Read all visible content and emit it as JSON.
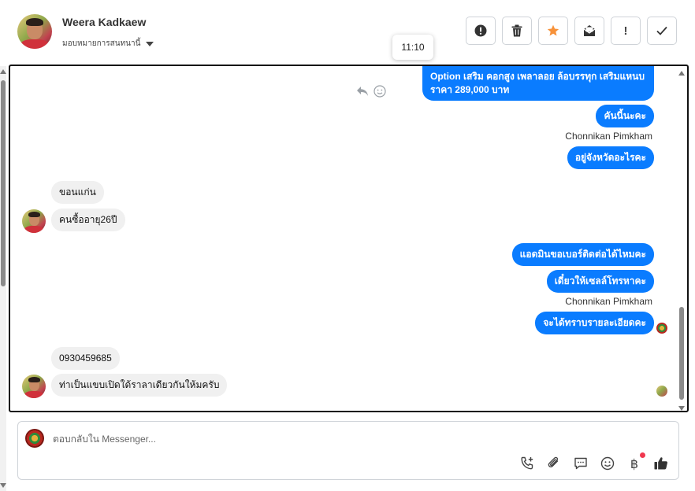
{
  "header": {
    "contact_name": "Weera Kadkaew",
    "assign_label": "มอบหมายการสนทนานี้",
    "toolbar": [
      {
        "name": "report-button",
        "icon": "alert-circle-icon"
      },
      {
        "name": "delete-button",
        "icon": "trash-icon"
      },
      {
        "name": "star-button",
        "icon": "star-icon"
      },
      {
        "name": "mark-unread-button",
        "icon": "envelope-icon",
        "label": ""
      },
      {
        "name": "important-button",
        "icon": "exclamation-icon",
        "label": "!"
      },
      {
        "name": "done-button",
        "icon": "check-icon"
      }
    ]
  },
  "tooltip": {
    "time": "11:10"
  },
  "messages": [
    {
      "id": "m1",
      "dir": "out",
      "lines": [
        " Option เสริม คอกสูง เพลาลอย ล้อบรรทุก เสริมแหนบ",
        "ราคา 289,000 บาท"
      ]
    },
    {
      "id": "m2",
      "dir": "out",
      "text": "คันนี้นะคะ"
    },
    {
      "id": "s1",
      "sender": "Chonnikan Pimkham"
    },
    {
      "id": "m3",
      "dir": "out",
      "text": "อยู่จังหวัดอะไรคะ"
    },
    {
      "id": "m4",
      "dir": "in",
      "text": "ขอนแก่น"
    },
    {
      "id": "m5",
      "dir": "in",
      "text": "คนซื้ออายุ26ปี"
    },
    {
      "id": "m6",
      "dir": "out",
      "text": "แอดมินขอเบอร์ติดต่อได้ไหมคะ"
    },
    {
      "id": "m7",
      "dir": "out",
      "text": "เดี๋ยวให้เซลล์โทรหาคะ"
    },
    {
      "id": "s2",
      "sender": "Chonnikan Pimkham"
    },
    {
      "id": "m8",
      "dir": "out",
      "text": "จะได้ทราบรายละเอียดคะ"
    },
    {
      "id": "m9",
      "dir": "in",
      "text": "0930459685"
    },
    {
      "id": "m10",
      "dir": "in",
      "text": "ท่าเป็นแขบเปิดใด้ราลาเดียวกันให้มครับ"
    }
  ],
  "composer": {
    "placeholder": "ตอบกลับใน Messenger...",
    "tools": [
      "add-call-icon",
      "paperclip-icon",
      "saved-reply-icon",
      "emoji-icon",
      "baht-icon",
      "like-icon"
    ],
    "baht_symbol": "฿"
  },
  "colors": {
    "accent": "#0a7cff",
    "incoming": "#f0f0f0",
    "star": "#f7923a",
    "notify_dot": "#f0384f"
  }
}
